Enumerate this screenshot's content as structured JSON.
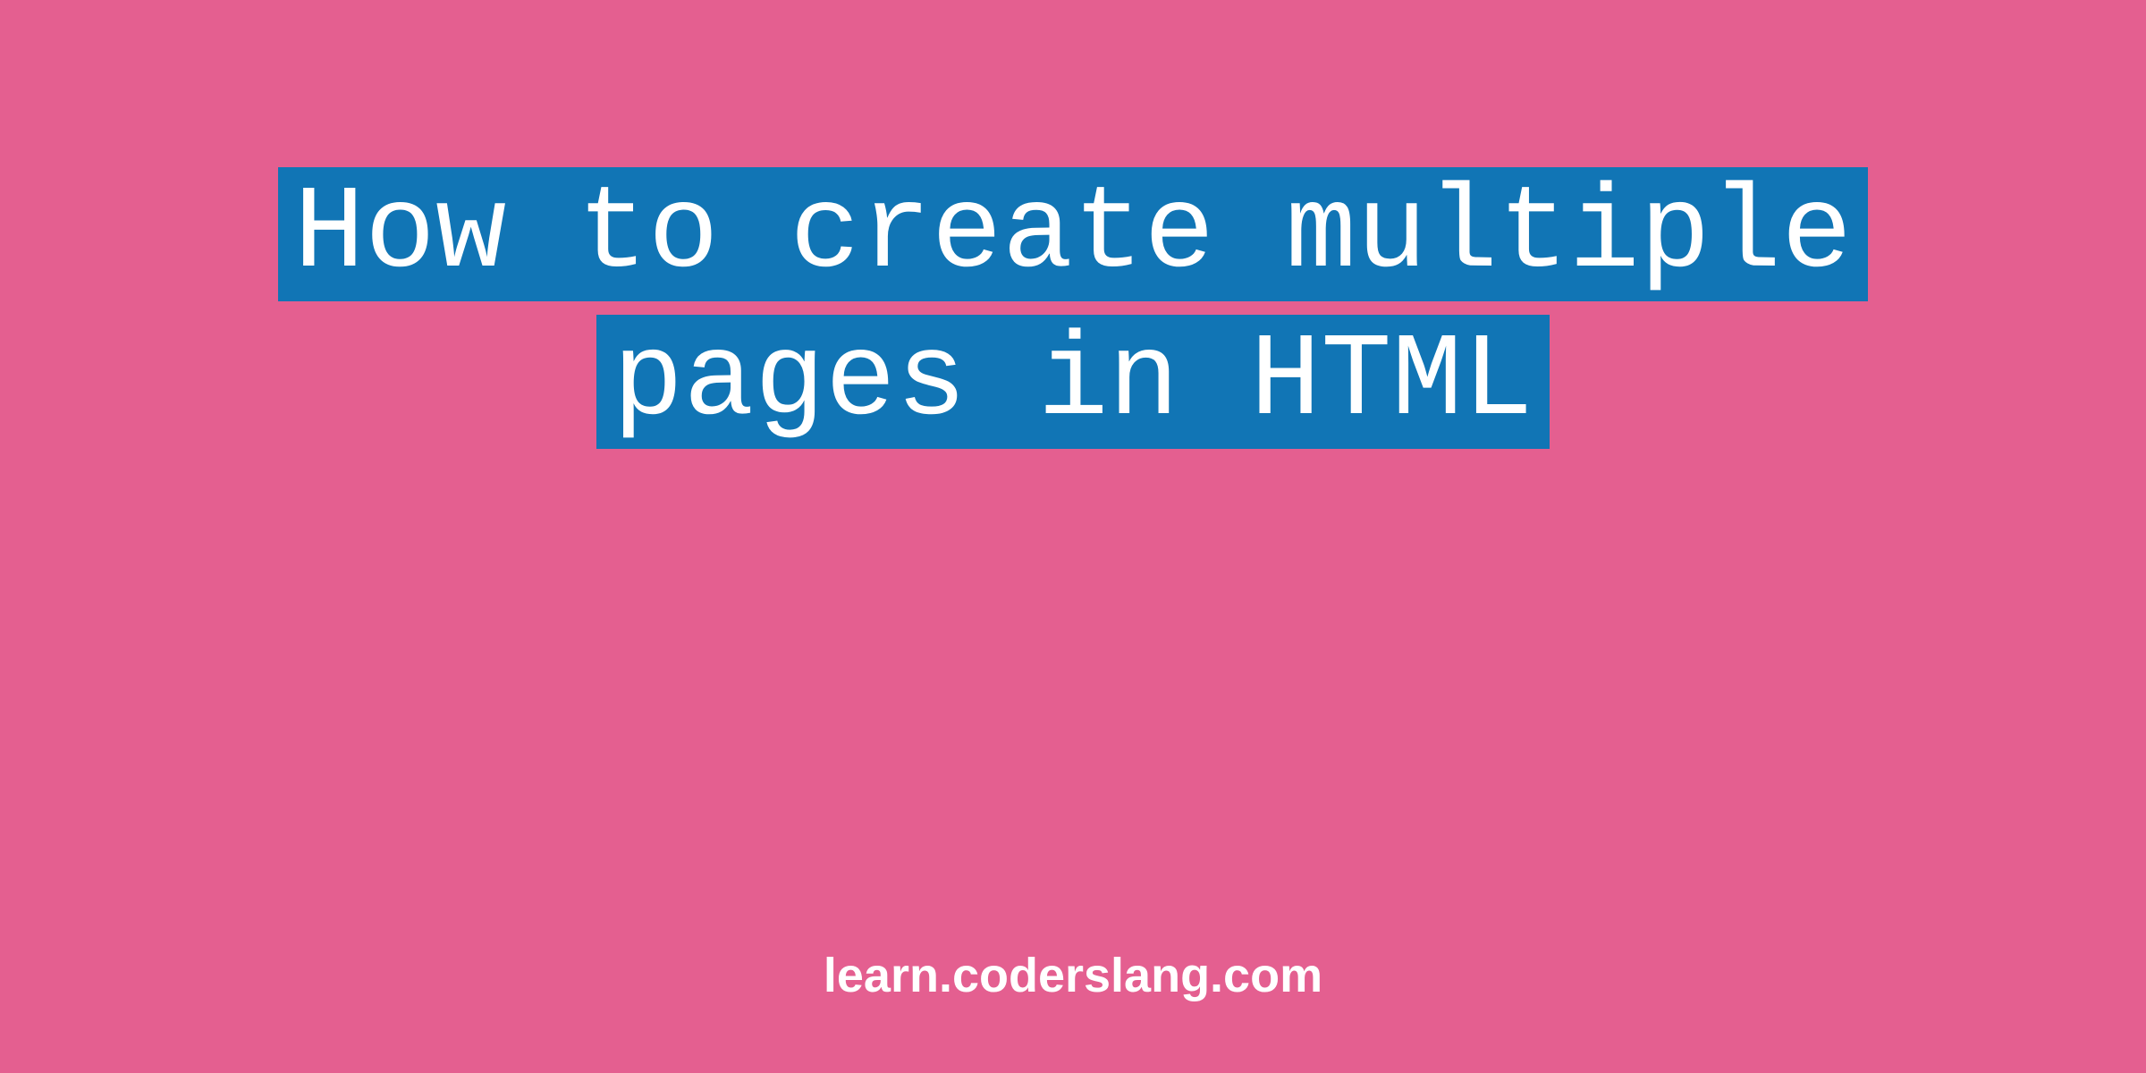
{
  "title": {
    "line1": "How to create multiple",
    "line2": "pages in HTML"
  },
  "footer": {
    "domain": "learn.coderslang.com"
  },
  "colors": {
    "background": "#e45f90",
    "highlight": "#1175b5",
    "text": "#ffffff"
  }
}
